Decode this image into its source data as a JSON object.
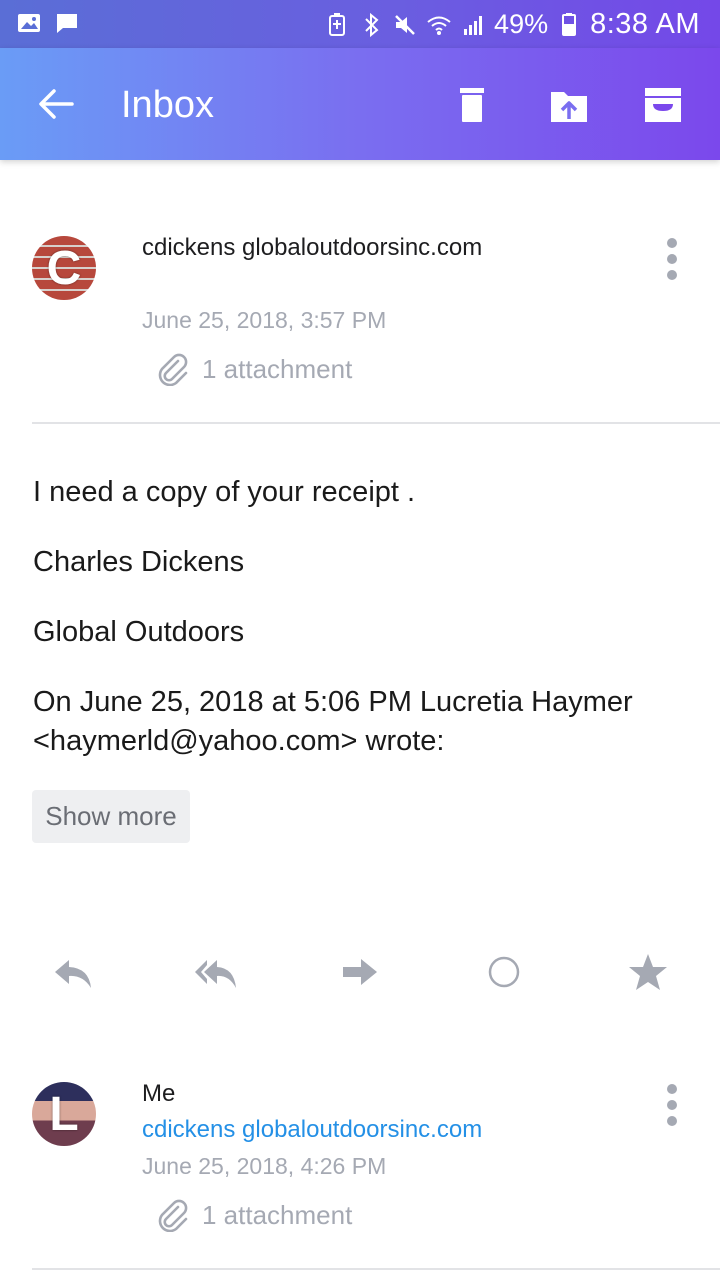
{
  "status_bar": {
    "battery": "49%",
    "time": "8:38 AM"
  },
  "app_bar": {
    "title": "Inbox",
    "icons": [
      "back-arrow-icon",
      "trash-icon",
      "move-to-folder-icon",
      "archive-icon"
    ]
  },
  "messages": [
    {
      "sender": "cdickens globaloutdoorsinc.com",
      "date": "June 25, 2018, 3:57 PM",
      "attachment_label": "1 attachment",
      "avatar_letter": "C",
      "body": [
        "I need a copy of your receipt .",
        "Charles Dickens",
        "Global Outdoors",
        "On June 25, 2018 at 5:06 PM Lucretia Haymer",
        "<haymerld@yahoo.com> wrote:"
      ],
      "show_more_label": "Show more",
      "actions": [
        "reply-icon",
        "reply-all-icon",
        "forward-icon",
        "mark-unread-icon",
        "star-icon"
      ]
    },
    {
      "sender": "Me",
      "recipient": "cdickens globaloutdoorsinc.com",
      "date": "June 25, 2018, 4:26 PM",
      "attachment_label": "1 attachment",
      "avatar_letter": "L"
    }
  ],
  "colors": {
    "accent_blue": "#2490e6",
    "muted_gray": "#a5a9b3"
  }
}
